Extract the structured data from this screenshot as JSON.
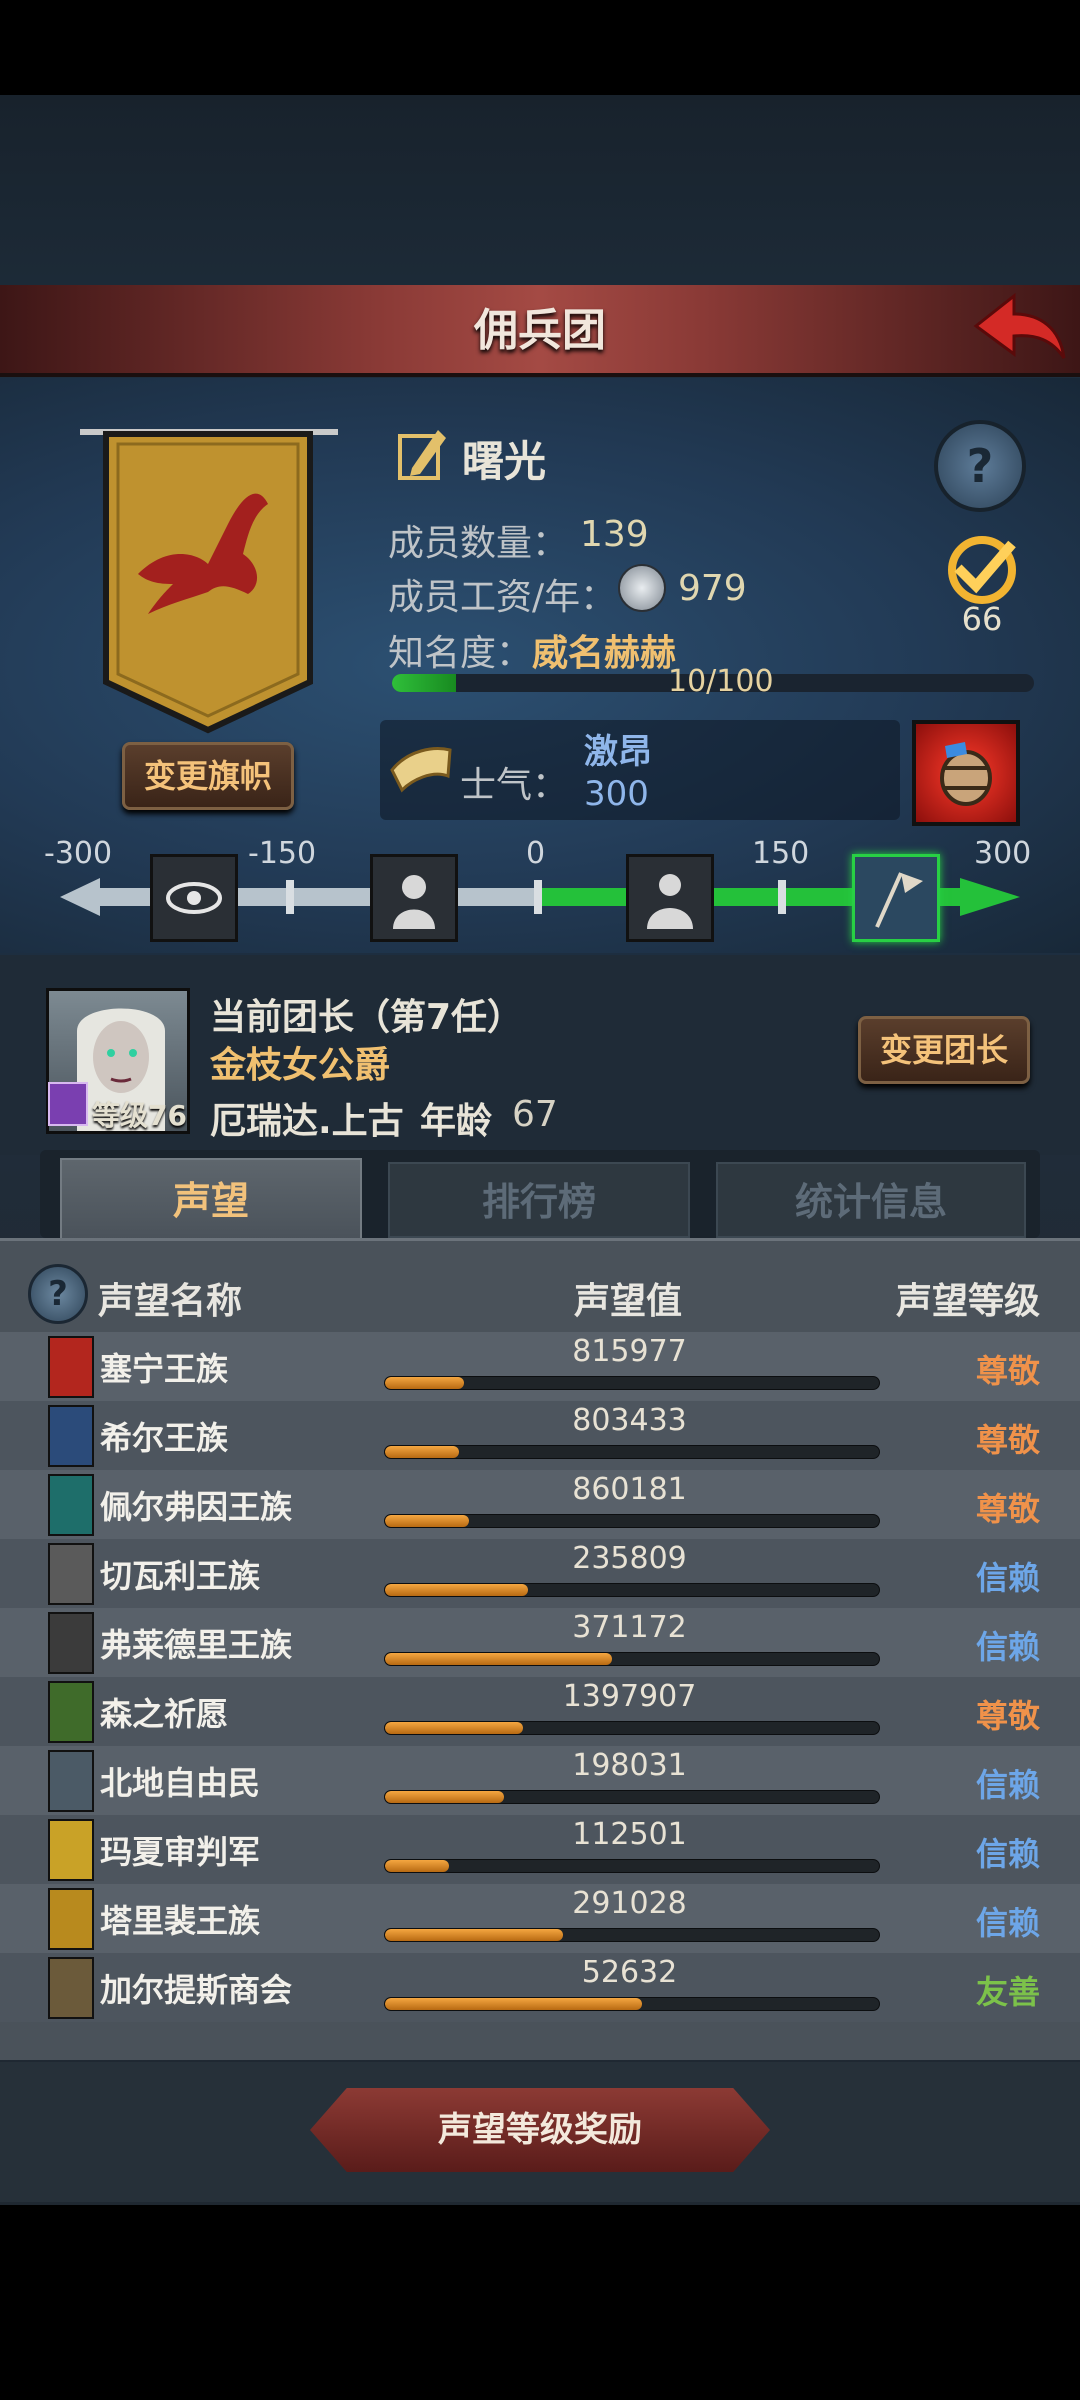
{
  "header": {
    "title": "佣兵团"
  },
  "guild": {
    "name": "曙光",
    "members_label": "成员数量：",
    "members_value": "139",
    "wage_label": "成员工资/年：",
    "wage_value": "979",
    "fame_label": "知名度：",
    "fame_value": "威名赫赫",
    "fame_progress_text": "10/100",
    "fame_progress_fraction": 0.1,
    "badge_count": "66",
    "change_banner": "变更旗帜"
  },
  "morale": {
    "label": "士气：",
    "state": "激昂",
    "value": "300",
    "ticks": [
      "-300",
      "-150",
      "0",
      "150",
      "300"
    ],
    "level_fraction": 1.0
  },
  "leader": {
    "title": "当前团长（第7任）",
    "rank_title": "金枝女公爵",
    "name": "厄瑞达.上古",
    "age_label": "年龄",
    "age": "67",
    "level_text": "等级76",
    "change_leader": "变更团长"
  },
  "tabs": [
    "声望",
    "排行榜",
    "统计信息"
  ],
  "reputation": {
    "col_name": "声望名称",
    "col_value": "声望值",
    "col_rank": "声望等级",
    "rows": [
      {
        "name": "塞宁王族",
        "value": "815977",
        "rank": "尊敬",
        "fill": 0.16,
        "rankColor": "#f0924a",
        "crestColor": "#b3261e"
      },
      {
        "name": "希尔王族",
        "value": "803433",
        "rank": "尊敬",
        "fill": 0.15,
        "rankColor": "#f0924a",
        "crestColor": "#2b4b7a"
      },
      {
        "name": "佩尔弗因王族",
        "value": "860181",
        "rank": "尊敬",
        "fill": 0.17,
        "rankColor": "#f0924a",
        "crestColor": "#1e6e6a"
      },
      {
        "name": "切瓦利王族",
        "value": "235809",
        "rank": "信赖",
        "fill": 0.29,
        "rankColor": "#6da6e8",
        "crestColor": "#5a5a5a"
      },
      {
        "name": "弗莱德里王族",
        "value": "371172",
        "rank": "信赖",
        "fill": 0.46,
        "rankColor": "#6da6e8",
        "crestColor": "#3b3b3b"
      },
      {
        "name": "森之祈愿",
        "value": "1397907",
        "rank": "尊敬",
        "fill": 0.28,
        "rankColor": "#f0924a",
        "crestColor": "#3f6b2a"
      },
      {
        "name": "北地自由民",
        "value": "198031",
        "rank": "信赖",
        "fill": 0.24,
        "rankColor": "#6da6e8",
        "crestColor": "#4b5a66"
      },
      {
        "name": "玛夏审判军",
        "value": "112501",
        "rank": "信赖",
        "fill": 0.13,
        "rankColor": "#6da6e8",
        "crestColor": "#c9a227"
      },
      {
        "name": "塔里裴王族",
        "value": "291028",
        "rank": "信赖",
        "fill": 0.36,
        "rankColor": "#6da6e8",
        "crestColor": "#b88a1e"
      },
      {
        "name": "加尔提斯商会",
        "value": "52632",
        "rank": "友善",
        "fill": 0.52,
        "rankColor": "#7cc24a",
        "crestColor": "#6b5a3a"
      }
    ]
  },
  "reward_button": "声望等级奖励"
}
